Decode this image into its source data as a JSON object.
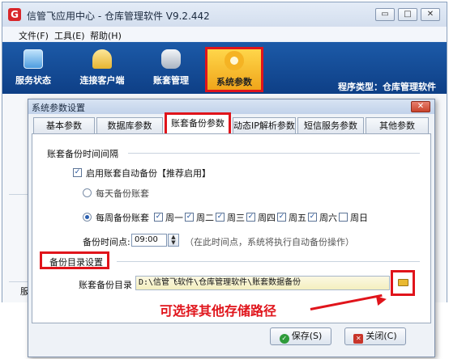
{
  "window": {
    "title": "信管飞应用中心 - 仓库管理软件 V9.2.442",
    "app_icon_glyph": "G",
    "minimize_glyph": "▭",
    "maximize_glyph": "□",
    "close_glyph": "✕"
  },
  "menu": {
    "items": [
      "文件(F)",
      "工具(E)",
      "帮助(H)"
    ]
  },
  "toolbar": {
    "items": [
      {
        "label": "服务状态",
        "icon": "monitor-icon",
        "color": "#6fb6f0"
      },
      {
        "label": "连接客户端",
        "icon": "users-icon",
        "color": "#f2c94c"
      },
      {
        "label": "账套管理",
        "icon": "database-icon",
        "color": "#c9d2dd"
      },
      {
        "label": "系统参数",
        "icon": "gear-icon",
        "color": "#f5b323"
      }
    ],
    "program_type": "程序类型：仓库管理软件"
  },
  "dialog": {
    "title": "系统参数设置",
    "close_glyph": "✕",
    "tabs": [
      "基本参数",
      "数据库参数",
      "账套备份参数",
      "动态IP解析参数",
      "短信服务参数",
      "其他参数"
    ],
    "backup_interval": {
      "title": "账套备份时间间隔",
      "enable_label": "启用账套自动备份【推荐启用】",
      "enable_checked": true,
      "daily_label": "每天备份账套",
      "weekly_label": "每周备份账套",
      "weekly_selected": true,
      "days": [
        {
          "label": "周一",
          "checked": true
        },
        {
          "label": "周二",
          "checked": true
        },
        {
          "label": "周三",
          "checked": true
        },
        {
          "label": "周四",
          "checked": true
        },
        {
          "label": "周五",
          "checked": true
        },
        {
          "label": "周六",
          "checked": true
        },
        {
          "label": "周日",
          "checked": false
        }
      ],
      "time_label": "备份时间点:",
      "time_value": "09:00",
      "time_hint": "（在此时间点，系统将执行自动备份操作）"
    },
    "backup_dir": {
      "title": "备份目录设置",
      "path_label": "账套备份目录",
      "path_value": "D:\\信管飞软件\\仓库管理软件\\账套数据备份",
      "browse_icon": "folder-icon"
    },
    "annotation": "可选择其他存储路径",
    "buttons": {
      "save": "保存(S)",
      "close": "关闭(C)"
    }
  },
  "background_fragment": "服"
}
